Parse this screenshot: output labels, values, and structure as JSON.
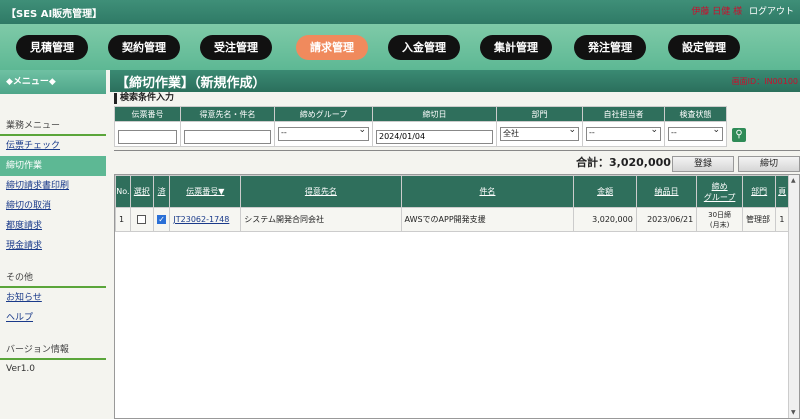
{
  "header": {
    "app_title": "【SES AI販売管理】",
    "user_name": "伊藤 日健 様",
    "logout_label": "ログアウト"
  },
  "nav": [
    "見積管理",
    "契約管理",
    "受注管理",
    "請求管理",
    "入金管理",
    "集計管理",
    "発注管理",
    "設定管理"
  ],
  "nav_active_index": 3,
  "sidebar": {
    "head": "◆メニュー◆",
    "business_section": "業務メニュー",
    "business_items": [
      "伝票チェック",
      "締切作業",
      "締切請求書印刷",
      "締切の取消",
      "都度請求",
      "現金請求"
    ],
    "active_index": 1,
    "other_section": "その他",
    "other_items": [
      "お知らせ",
      "ヘルプ"
    ],
    "version_section": "バージョン情報",
    "version": "Ver1.0"
  },
  "page": {
    "title": "【締切作業】（新規作成）",
    "screen_id": "画面ID：IN00100",
    "section_label": "検索条件入力"
  },
  "search": {
    "headers": [
      "伝票番号",
      "得意先名・件名",
      "締めグループ",
      "締切日",
      "部門",
      "自社担当者",
      "検査状態"
    ],
    "slip_no": "",
    "customer": "",
    "group": "--",
    "close_date": "2024/01/04",
    "dept": "全社",
    "staff": "--",
    "inspect": "--"
  },
  "summary": {
    "total_label": "合計：",
    "total_value": "3,020,000",
    "register_button": "登録",
    "close_button": "締切"
  },
  "results": {
    "headers": [
      "No.",
      "選択",
      "済",
      "伝票番号▼",
      "得意先名",
      "件名",
      "金額",
      "納品日",
      "締め\nグループ",
      "部門",
      "頁"
    ],
    "rows": [
      {
        "no": "1",
        "selected": false,
        "done": true,
        "slip_no": "JT23062-1748",
        "customer": "システム開発合同会社",
        "subject": "AWSでのAPP開発支援",
        "amount": "3,020,000",
        "delivery": "2023/06/21",
        "group_line1": "30日締",
        "group_line2": "(月末)",
        "dept": "管理部",
        "page": "1"
      }
    ]
  },
  "colors": {
    "accent": "#2f6f5c",
    "nav_active": "#f08a5d",
    "nav_bg": "#5db894"
  }
}
